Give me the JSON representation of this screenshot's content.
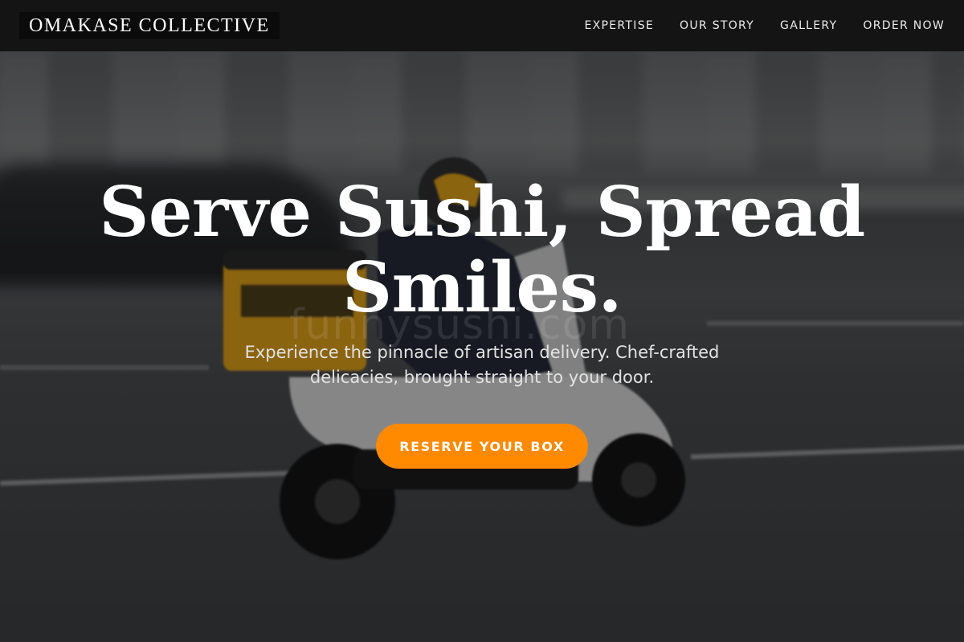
{
  "brand": {
    "name": "OMAKASE COLLECTIVE"
  },
  "nav": {
    "items": [
      {
        "label": "EXPERTISE"
      },
      {
        "label": "OUR STORY"
      },
      {
        "label": "GALLERY"
      },
      {
        "label": "ORDER NOW"
      }
    ]
  },
  "hero": {
    "headline_line1": "Serve Sushi, Spread",
    "headline_line2": "Smiles.",
    "subtitle": "Experience the pinnacle of artisan delivery. Chef-crafted delicacies, brought straight to your door.",
    "cta_label": "RESERVE YOUR BOX",
    "watermark": "funnysushi.com",
    "background_description_icon": "delivery-scooter-image"
  },
  "colors": {
    "accent": "#ff8a00",
    "navbar": "#121212",
    "text": "#ffffff"
  }
}
